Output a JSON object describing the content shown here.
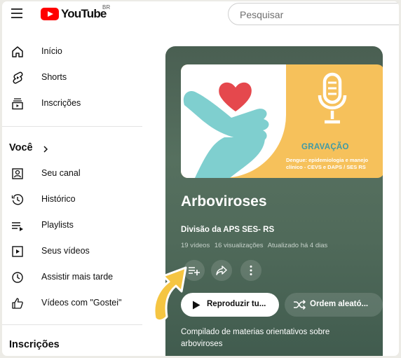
{
  "header": {
    "brand": "YouTube",
    "region": "BR",
    "search_placeholder": "Pesquisar"
  },
  "sidebar": {
    "main_items": [
      {
        "label": "Início",
        "icon": "home-icon"
      },
      {
        "label": "Shorts",
        "icon": "shorts-icon"
      },
      {
        "label": "Inscrições",
        "icon": "subscriptions-icon"
      }
    ],
    "you_section": "Você",
    "you_items": [
      {
        "label": "Seu canal",
        "icon": "your-channel-icon"
      },
      {
        "label": "Histórico",
        "icon": "history-icon"
      },
      {
        "label": "Playlists",
        "icon": "playlists-icon"
      },
      {
        "label": "Seus vídeos",
        "icon": "your-videos-icon"
      },
      {
        "label": "Assistir mais tarde",
        "icon": "watch-later-icon"
      },
      {
        "label": "Vídeos com \"Gostei\"",
        "icon": "liked-videos-icon"
      }
    ],
    "subscriptions_section": "Inscrições"
  },
  "playlist": {
    "thumbnail": {
      "title": "GRAVAÇÃO",
      "subtitle": "Dengue: epidemiologia e manejo clínico - CEVS e DAPS / SES RS"
    },
    "title": "Arboviroses",
    "channel": "Divisão da APS SES- RS",
    "videos": "19 vídeos",
    "views": "16 visualizações",
    "updated": "Atualizado há 4 dias",
    "play_all": "Reproduzir tu...",
    "shuffle": "Ordem aleató...",
    "description": "Compilado de materias orientativos sobre arboviroses"
  },
  "colors": {
    "brand_red": "#ff0000",
    "panel_green": "#56705f",
    "thumb_orange": "#f6c15b",
    "arrow_yellow": "#f5c542"
  }
}
